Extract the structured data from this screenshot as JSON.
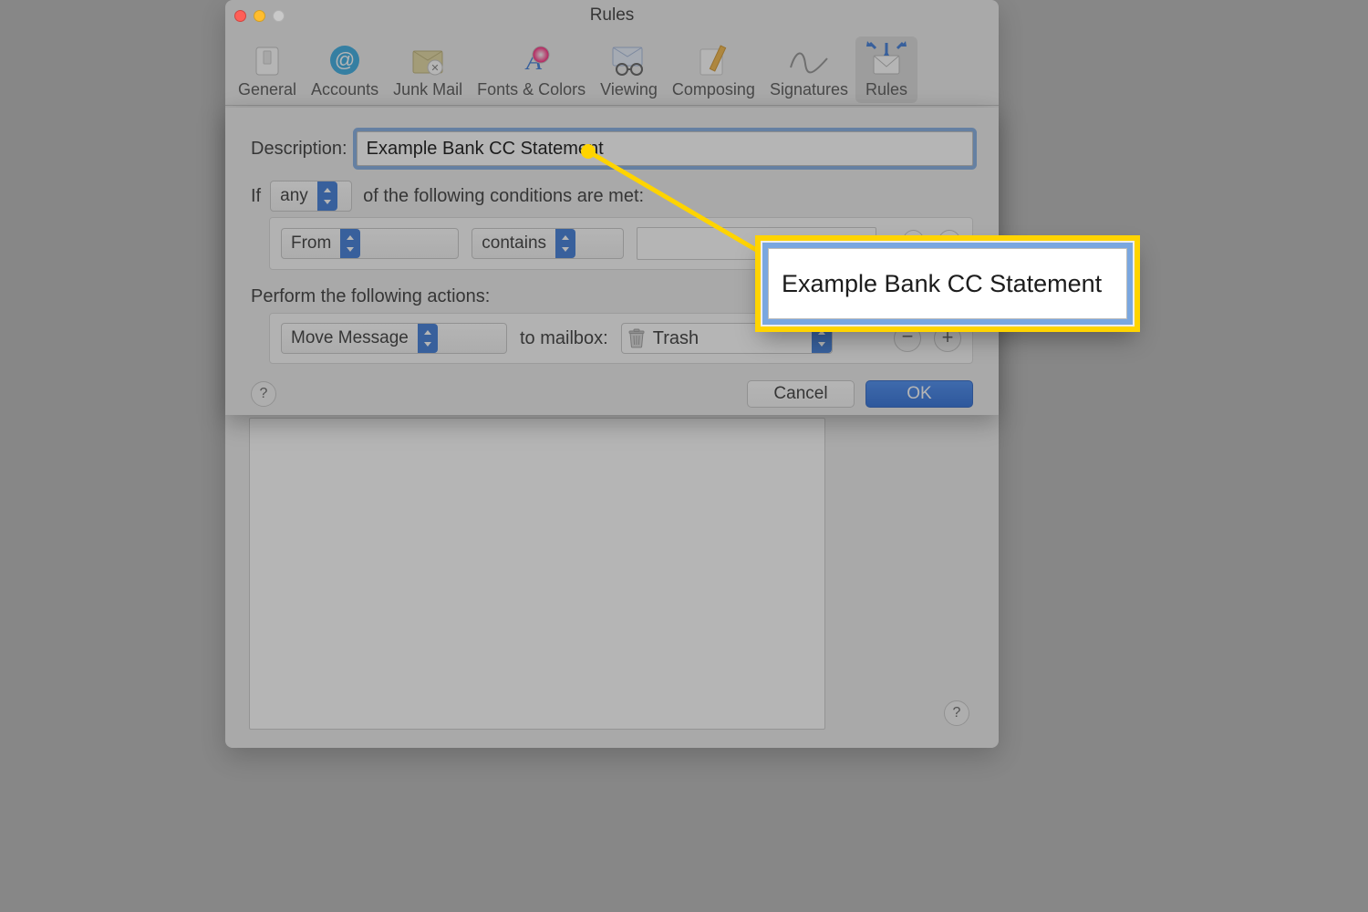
{
  "window": {
    "title": "Rules"
  },
  "toolbar": {
    "tabs": [
      {
        "label": "General"
      },
      {
        "label": "Accounts"
      },
      {
        "label": "Junk Mail"
      },
      {
        "label": "Fonts & Colors"
      },
      {
        "label": "Viewing"
      },
      {
        "label": "Composing"
      },
      {
        "label": "Signatures"
      },
      {
        "label": "Rules"
      }
    ],
    "active_index": 7
  },
  "sheet": {
    "description_label": "Description:",
    "description_value": "Example Bank CC Statement",
    "if_label": "If",
    "match_scope": "any",
    "conditions_tail": "of the following conditions are met:",
    "conditions": [
      {
        "field": "From",
        "op": "contains",
        "value": ""
      }
    ],
    "actions_label": "Perform the following actions:",
    "actions": [
      {
        "verb": "Move Message",
        "to_label": "to mailbox:",
        "mailbox": "Trash"
      }
    ],
    "buttons": {
      "minus": "−",
      "plus": "+",
      "help": "?",
      "cancel": "Cancel",
      "ok": "OK"
    }
  },
  "callout": {
    "text": "Example Bank CC Statement"
  },
  "misc": {
    "help": "?"
  }
}
